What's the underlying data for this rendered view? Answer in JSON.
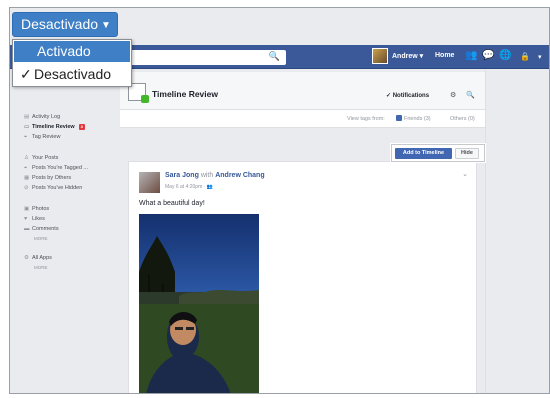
{
  "dropdown": {
    "selected": "Desactivado",
    "options": [
      {
        "label": "Activado",
        "checked": false,
        "highlighted": true
      },
      {
        "label": "Desactivado",
        "checked": true,
        "highlighted": false
      }
    ],
    "check_mark": "✓",
    "accent": "#3f7fc6"
  },
  "topbar": {
    "profile_name": "Andrew ▾",
    "home": "Home",
    "search_icon": "search-icon",
    "brand_color": "#3b5998"
  },
  "page_header": {
    "title": "Timeline Review",
    "notifications": "✓ Notifications"
  },
  "tags_filter": {
    "label": "View tags from:",
    "friends": "Friends (3)",
    "others": "Others (0)"
  },
  "sidebar": {
    "activity_log": "Activity Log",
    "timeline_review": "Timeline Review",
    "timeline_review_badge": "3",
    "tag_review": "Tag Review",
    "your_posts": "Your Posts",
    "posts_tagged": "Posts You're Tagged ...",
    "posts_by_others": "Posts by Others",
    "posts_hidden": "Posts You've Hidden",
    "photos": "Photos",
    "likes": "Likes",
    "comments": "Comments",
    "more_1": "MORE",
    "all_apps": "All Apps",
    "more_2": "MORE"
  },
  "actions": {
    "add": "Add to Timeline",
    "hide": "Hide"
  },
  "post": {
    "author": "Sara Jong",
    "with_word": "with",
    "tagged": "Andrew Chang",
    "date": "May 6 at 4:20pm · ",
    "text": "What a beautiful day!"
  }
}
